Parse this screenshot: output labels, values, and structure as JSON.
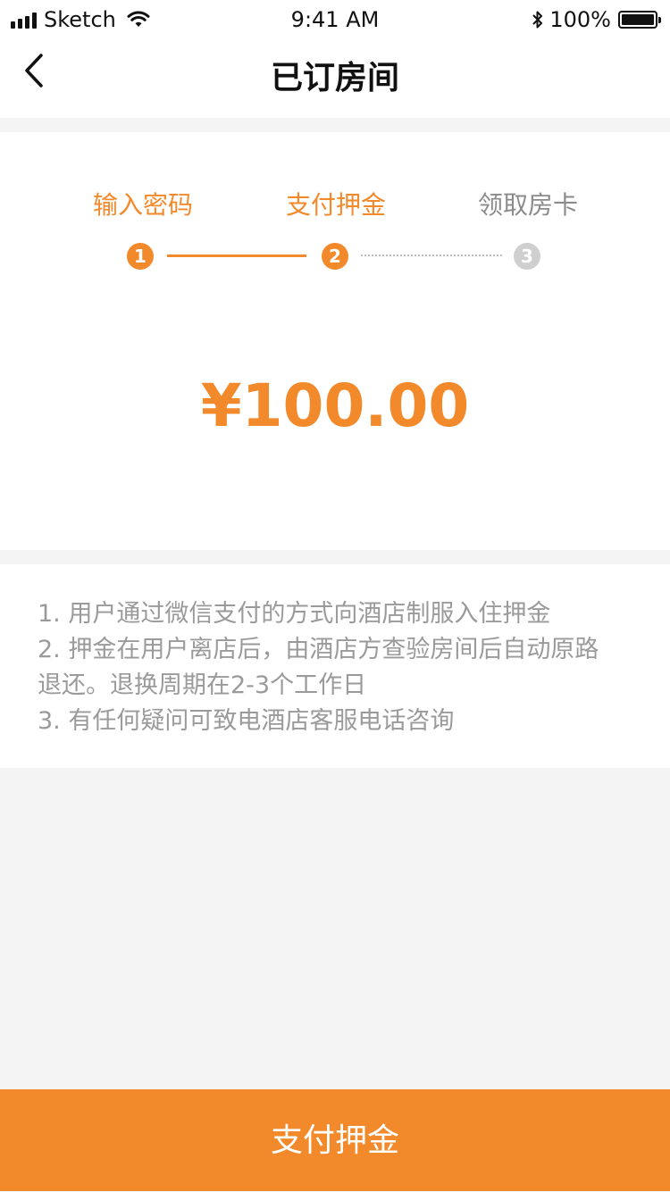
{
  "status_bar": {
    "carrier": "Sketch",
    "time": "9:41 AM",
    "battery": "100%"
  },
  "nav": {
    "title": "已订房间",
    "back_icon": "chevron-left-icon"
  },
  "steps": [
    {
      "label": "输入密码",
      "number": "1",
      "state": "active"
    },
    {
      "label": "支付押金",
      "number": "2",
      "state": "active"
    },
    {
      "label": "领取房卡",
      "number": "3",
      "state": "inactive"
    }
  ],
  "deposit": {
    "amount": "¥100.00"
  },
  "notes": [
    "1. 用户通过微信支付的方式向酒店制服入住押金",
    "2. 押金在用户离店后，由酒店方查验房间后自动原路",
    "退还。退换周期在2-3个工作日",
    "3. 有任何疑问可致电酒店客服电话咨询"
  ],
  "action": {
    "pay_label": "支付押金"
  },
  "colors": {
    "accent": "#f2892a",
    "inactive": "#cfcfcf",
    "background": "#f4f4f4"
  }
}
